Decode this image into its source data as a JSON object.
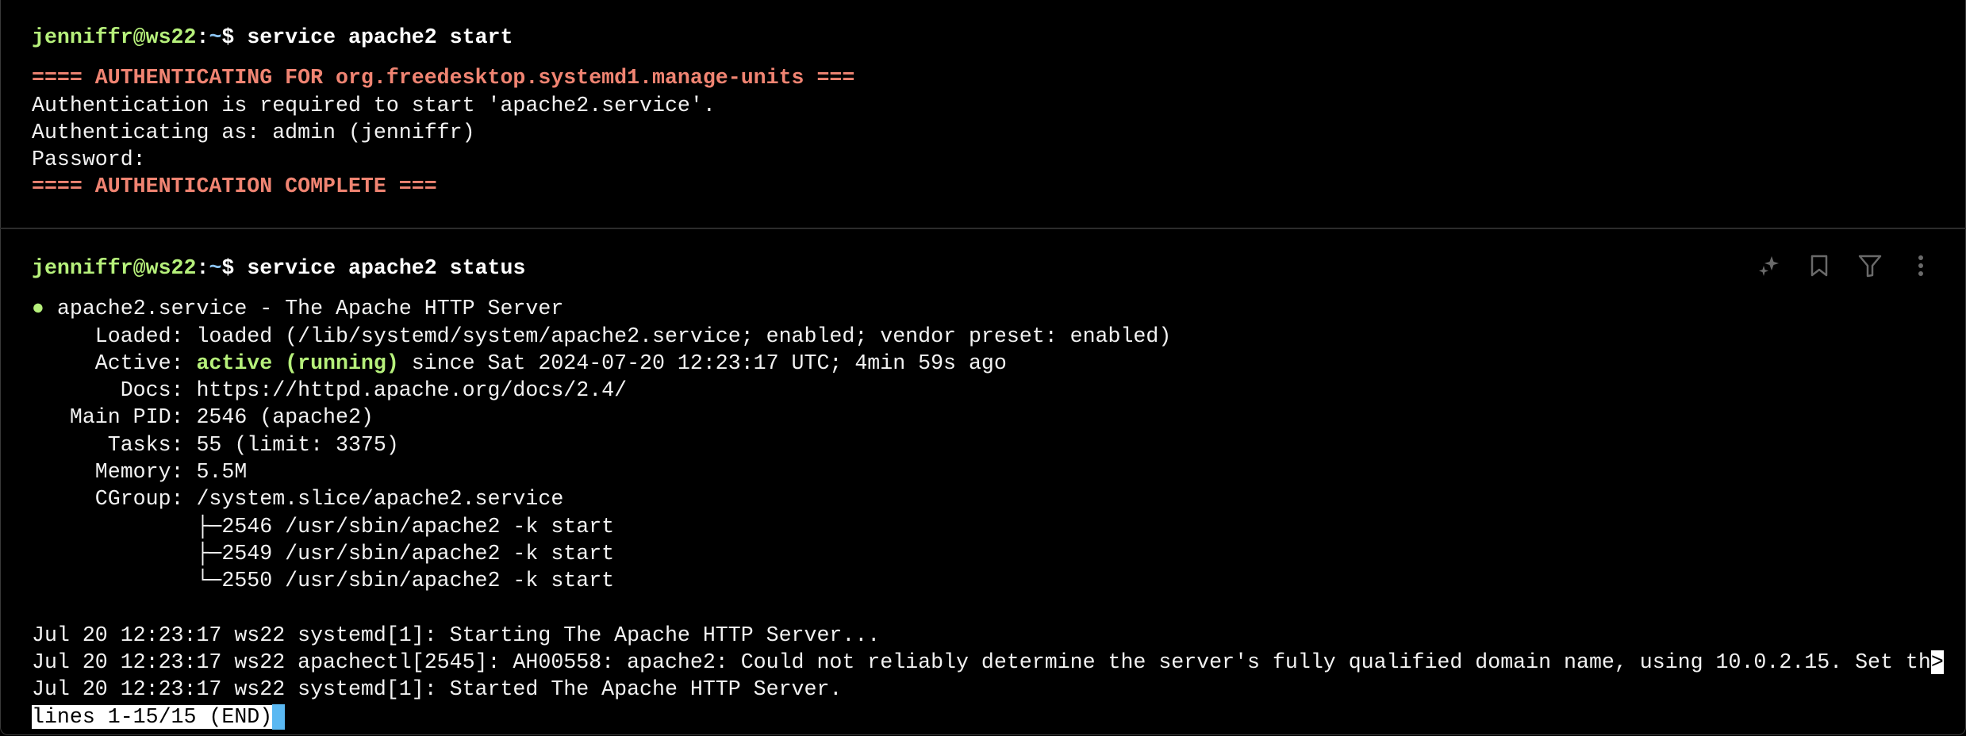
{
  "prompt": {
    "user_host": "jenniffr@ws22",
    "sep": ":",
    "path": "~",
    "symbol": "$"
  },
  "block1": {
    "command": "service apache2 start",
    "auth_header": "==== AUTHENTICATING FOR org.freedesktop.systemd1.manage-units ===",
    "lines": [
      "Authentication is required to start 'apache2.service'.",
      "Authenticating as: admin (jenniffr)",
      "Password:"
    ],
    "auth_footer": "==== AUTHENTICATION COMPLETE ==="
  },
  "block2": {
    "command": "service apache2 status",
    "toolbar": {
      "ai_icon": "sparkles-icon",
      "bookmark_icon": "bookmark-icon",
      "filter_icon": "filter-icon",
      "more_icon": "more-vertical-icon"
    },
    "status_dot": "●",
    "unit_line": "apache2.service - The Apache HTTP Server",
    "loaded": "     Loaded: loaded (/lib/systemd/system/apache2.service; enabled; vendor preset: enabled)",
    "active_label": "     Active: ",
    "active_state": "active (running)",
    "active_rest": " since Sat 2024-07-20 12:23:17 UTC; 4min 59s ago",
    "details": [
      "       Docs: https://httpd.apache.org/docs/2.4/",
      "   Main PID: 2546 (apache2)",
      "      Tasks: 55 (limit: 3375)",
      "     Memory: 5.5M",
      "     CGroup: /system.slice/apache2.service",
      "             ├─2546 /usr/sbin/apache2 -k start",
      "             ├─2549 /usr/sbin/apache2 -k start",
      "             └─2550 /usr/sbin/apache2 -k start"
    ],
    "journal": [
      "Jul 20 12:23:17 ws22 systemd[1]: Starting The Apache HTTP Server...",
      "Jul 20 12:23:17 ws22 apachectl[2545]: AH00558: apache2: Could not reliably determine the server's fully qualified domain name, using 10.0.2.15. Set th",
      "Jul 20 12:23:17 ws22 systemd[1]: Started The Apache HTTP Server."
    ],
    "truncation_marker": ">",
    "pager_status": "lines 1-15/15 (END)"
  }
}
